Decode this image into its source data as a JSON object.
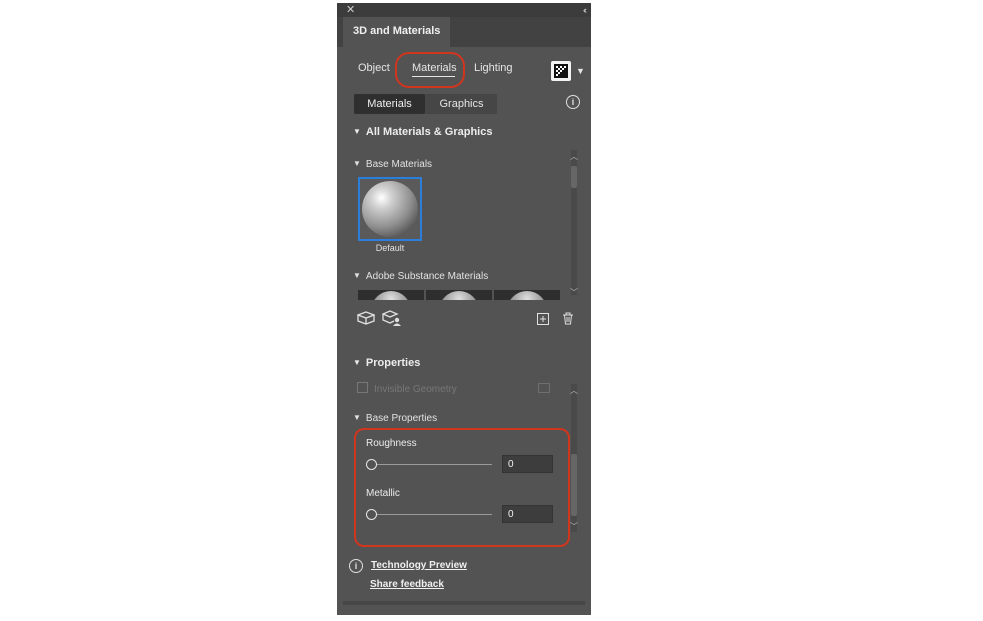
{
  "panel": {
    "close_icon": "close-icon",
    "collapse_icon": "double-chevron-icon",
    "title": "3D and Materials"
  },
  "tabs": {
    "object": "Object",
    "materials": "Materials",
    "lighting": "Lighting",
    "active": "Materials"
  },
  "toolbar": {
    "render_icon": "render-icon",
    "render_menu_icon": "chevron-down-icon"
  },
  "segmented": {
    "materials": "Materials",
    "graphics": "Graphics",
    "selected": "Materials"
  },
  "info_icon": "info-icon",
  "library": {
    "heading": "All Materials & Graphics",
    "base_materials": {
      "heading": "Base Materials",
      "items": [
        {
          "label": "Default",
          "selected": true
        }
      ]
    },
    "substance_materials": {
      "heading": "Adobe Substance Materials"
    }
  },
  "library_actions": {
    "add_material_icon": "cube-icon",
    "add_graphic_icon": "cube-user-icon",
    "new_icon": "plus-square-icon",
    "delete_icon": "trash-icon"
  },
  "properties": {
    "heading": "Properties",
    "hidden_row": "Invisible Geometry",
    "base_heading": "Base Properties",
    "roughness": {
      "label": "Roughness",
      "value": "0"
    },
    "metallic": {
      "label": "Metallic",
      "value": "0"
    }
  },
  "footer": {
    "tech_preview": "Technology Preview",
    "share_feedback": "Share feedback"
  },
  "colors": {
    "panel_bg": "#535353",
    "highlight_ring": "#d0351d",
    "selection_border": "#2b7fd9"
  }
}
